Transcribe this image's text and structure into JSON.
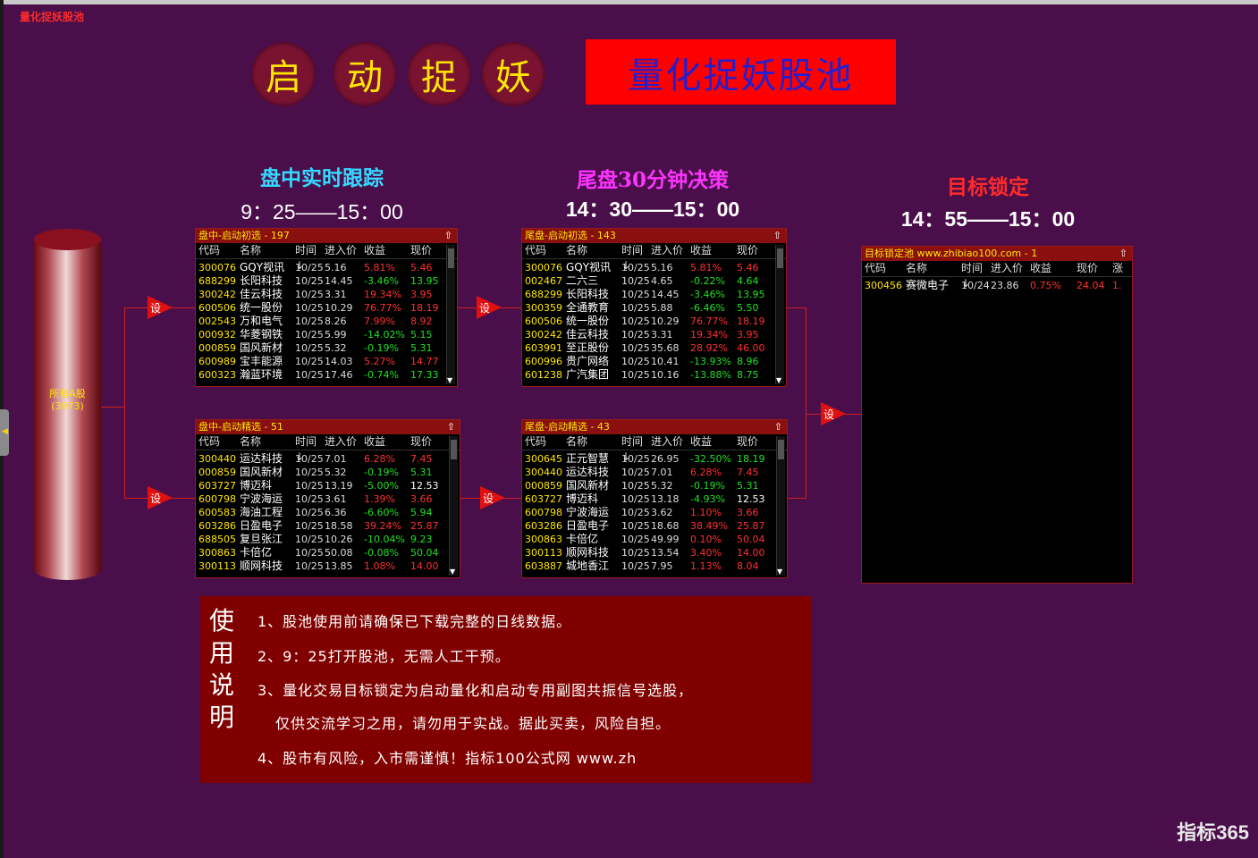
{
  "app_title": "量化捉妖股池",
  "circles": [
    "启",
    "动",
    "捉",
    "妖"
  ],
  "banner": "量化捉妖股池",
  "sections": {
    "s1": {
      "title": "盘中实时跟踪",
      "time": "9：25——15：00"
    },
    "s2": {
      "title": "尾盘30分钟决策",
      "time": "14：30——15：00"
    },
    "s3": {
      "title": "目标锁定",
      "time": "14：55——15：00"
    }
  },
  "colors": {
    "background": "#4a0f4a",
    "accent": "#ff0000",
    "banner_text": "#2020d0",
    "up": "#ff3030",
    "down": "#20e020",
    "code": "#ffe600"
  },
  "cylinder": {
    "label": "所有A股",
    "count": "(3973)"
  },
  "set_label": "设",
  "column_headers": {
    "code": "代码",
    "name": "名称",
    "time": "时间↓",
    "entry": "进入价",
    "gain": "收益",
    "price": "现价",
    "extra": "涨"
  },
  "panels": {
    "p1": {
      "title": "盘中-启动初选 - 197",
      "rows": [
        [
          "300076",
          "GQY视讯",
          "10/25",
          "5.16",
          "5.81%",
          "5.46"
        ],
        [
          "688299",
          "长阳科技",
          "10/25",
          "14.45",
          "-3.46%",
          "13.95"
        ],
        [
          "300242",
          "佳云科技",
          "10/25",
          "3.31",
          "19.34%",
          "3.95"
        ],
        [
          "600506",
          "统一股份",
          "10/25",
          "10.29",
          "76.77%",
          "18.19"
        ],
        [
          "002543",
          "万和电气",
          "10/25",
          "8.26",
          "7.99%",
          "8.92"
        ],
        [
          "000932",
          "华菱钢铁",
          "10/25",
          "5.99",
          "-14.02%",
          "5.15"
        ],
        [
          "000859",
          "国风新材",
          "10/25",
          "5.32",
          "-0.19%",
          "5.31"
        ],
        [
          "600989",
          "宝丰能源",
          "10/25",
          "14.03",
          "5.27%",
          "14.77"
        ],
        [
          "600323",
          "瀚蓝环境",
          "10/25",
          "17.46",
          "-0.74%",
          "17.33"
        ]
      ]
    },
    "p2": {
      "title": "盘中-启动精选 - 51",
      "rows": [
        [
          "300440",
          "运达科技",
          "10/25",
          "7.01",
          "6.28%",
          "7.45"
        ],
        [
          "000859",
          "国风新材",
          "10/25",
          "5.32",
          "-0.19%",
          "5.31"
        ],
        [
          "603727",
          "博迈科",
          "10/25",
          "13.19",
          "-5.00%",
          "12.53"
        ],
        [
          "600798",
          "宁波海运",
          "10/25",
          "3.61",
          "1.39%",
          "3.66"
        ],
        [
          "600583",
          "海油工程",
          "10/25",
          "6.36",
          "-6.60%",
          "5.94"
        ],
        [
          "603286",
          "日盈电子",
          "10/25",
          "18.58",
          "39.24%",
          "25.87"
        ],
        [
          "688505",
          "复旦张江",
          "10/25",
          "10.26",
          "-10.04%",
          "9.23"
        ],
        [
          "300863",
          "卡倍亿",
          "10/25",
          "50.08",
          "-0.08%",
          "50.04"
        ],
        [
          "300113",
          "顺网科技",
          "10/25",
          "13.85",
          "1.08%",
          "14.00"
        ]
      ]
    },
    "p3": {
      "title": "尾盘-启动初选 - 143",
      "rows": [
        [
          "300076",
          "GQY视讯",
          "10/25",
          "5.16",
          "5.81%",
          "5.46"
        ],
        [
          "002467",
          "二六三",
          "10/25",
          "4.65",
          "-0.22%",
          "4.64"
        ],
        [
          "688299",
          "长阳科技",
          "10/25",
          "14.45",
          "-3.46%",
          "13.95"
        ],
        [
          "300359",
          "全通教育",
          "10/25",
          "5.88",
          "-6.46%",
          "5.50"
        ],
        [
          "600506",
          "统一股份",
          "10/25",
          "10.29",
          "76.77%",
          "18.19"
        ],
        [
          "300242",
          "佳云科技",
          "10/25",
          "3.31",
          "19.34%",
          "3.95"
        ],
        [
          "603991",
          "至正股份",
          "10/25",
          "35.68",
          "28.92%",
          "46.00"
        ],
        [
          "600996",
          "贵广网络",
          "10/25",
          "10.41",
          "-13.93%",
          "8.96"
        ],
        [
          "601238",
          "广汽集团",
          "10/25",
          "10.16",
          "-13.88%",
          "8.75"
        ]
      ]
    },
    "p4": {
      "title": "尾盘-启动精选 - 43",
      "rows": [
        [
          "300645",
          "正元智慧",
          "10/25",
          "26.95",
          "-32.50%",
          "18.19"
        ],
        [
          "300440",
          "运达科技",
          "10/25",
          "7.01",
          "6.28%",
          "7.45"
        ],
        [
          "000859",
          "国风新材",
          "10/25",
          "5.32",
          "-0.19%",
          "5.31"
        ],
        [
          "603727",
          "博迈科",
          "10/25",
          "13.18",
          "-4.93%",
          "12.53"
        ],
        [
          "600798",
          "宁波海运",
          "10/25",
          "3.62",
          "1.10%",
          "3.66"
        ],
        [
          "603286",
          "日盈电子",
          "10/25",
          "18.68",
          "38.49%",
          "25.87"
        ],
        [
          "300863",
          "卡倍亿",
          "10/25",
          "49.99",
          "0.10%",
          "50.04"
        ],
        [
          "300113",
          "顺网科技",
          "10/25",
          "13.54",
          "3.40%",
          "14.00"
        ],
        [
          "603887",
          "城地香江",
          "10/25",
          "7.95",
          "1.13%",
          "8.04"
        ]
      ]
    },
    "p5": {
      "title": "目标锁定池 www.zhibiao100.com - 1",
      "rows": [
        [
          "300456",
          "赛微电子",
          "10/24",
          "23.86",
          "0.75%",
          "24.04",
          "1."
        ]
      ]
    }
  },
  "usage": {
    "title": [
      "使",
      "用",
      "说",
      "明"
    ],
    "lines": [
      "1、股池使用前请确保已下载完整的日线数据。",
      "2、9：25打开股池，无需人工干预。",
      "3、量化交易目标锁定为启动量化和启动专用副图共振信号选股，",
      "仅供交流学习之用，请勿用于实战。据此买卖，风险自担。",
      "4、股市有风险，入市需谨慎！指标100公式网  www.zh"
    ]
  },
  "watermark": "指标365"
}
